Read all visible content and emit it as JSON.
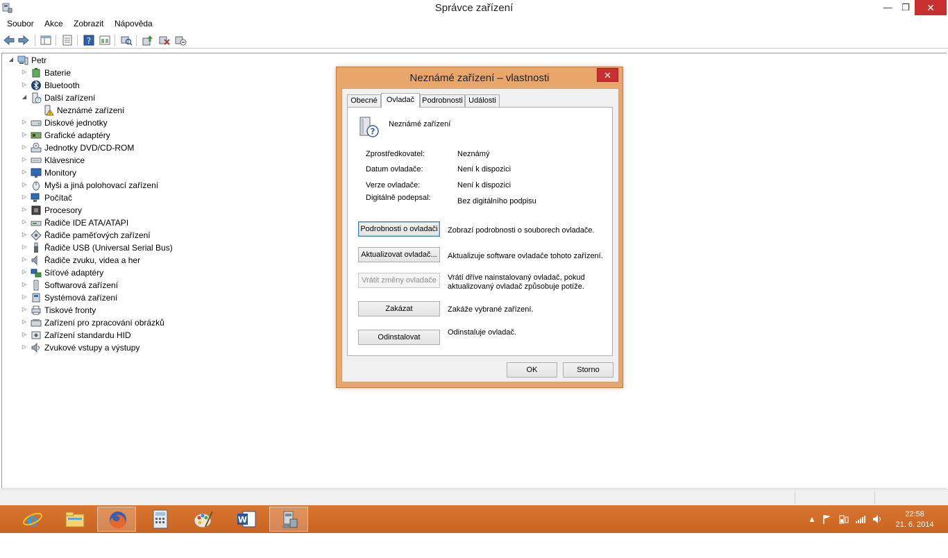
{
  "window": {
    "title": "Správce zařízení",
    "min_glyph": "—",
    "max_glyph": "❐",
    "close_glyph": "✕"
  },
  "menu": [
    "Soubor",
    "Akce",
    "Zobrazit",
    "Nápověda"
  ],
  "tree": {
    "root": "Petr",
    "items": [
      {
        "label": "Baterie",
        "icon": "battery-icon",
        "expanded": false
      },
      {
        "label": "Bluetooth",
        "icon": "bluetooth-icon",
        "expanded": false
      },
      {
        "label": "Další zařízení",
        "icon": "other-devices-icon",
        "expanded": true
      },
      {
        "label": "Neznámé zařízení",
        "icon": "unknown-device-warning-icon",
        "child": true
      },
      {
        "label": "Diskové jednotky",
        "icon": "disk-icon",
        "expanded": false
      },
      {
        "label": "Grafické adaptéry",
        "icon": "display-adapter-icon",
        "expanded": false
      },
      {
        "label": "Jednotky DVD/CD-ROM",
        "icon": "dvd-icon",
        "expanded": false
      },
      {
        "label": "Klávesnice",
        "icon": "keyboard-icon",
        "expanded": false
      },
      {
        "label": "Monitory",
        "icon": "monitor-icon",
        "expanded": false
      },
      {
        "label": "Myši a jiná polohovací zařízení",
        "icon": "mouse-icon",
        "expanded": false
      },
      {
        "label": "Počítač",
        "icon": "computer-icon",
        "expanded": false
      },
      {
        "label": "Procesory",
        "icon": "processor-icon",
        "expanded": false
      },
      {
        "label": "Řadiče IDE ATA/ATAPI",
        "icon": "ide-controller-icon",
        "expanded": false
      },
      {
        "label": "Řadiče paměťových zařízení",
        "icon": "storage-controller-icon",
        "expanded": false
      },
      {
        "label": "Řadiče USB (Universal Serial Bus)",
        "icon": "usb-icon",
        "expanded": false
      },
      {
        "label": "Řadiče zvuku, videa a her",
        "icon": "sound-icon",
        "expanded": false
      },
      {
        "label": "Síťové adaptéry",
        "icon": "network-adapter-icon",
        "expanded": false
      },
      {
        "label": "Softwarová zařízení",
        "icon": "software-device-icon",
        "expanded": false
      },
      {
        "label": "Systémová zařízení",
        "icon": "system-device-icon",
        "expanded": false
      },
      {
        "label": "Tiskové fronty",
        "icon": "printer-icon",
        "expanded": false
      },
      {
        "label": "Zařízení pro zpracování obrázků",
        "icon": "imaging-device-icon",
        "expanded": false
      },
      {
        "label": "Zařízení standardu HID",
        "icon": "hid-icon",
        "expanded": false
      },
      {
        "label": "Zvukové vstupy a výstupy",
        "icon": "audio-io-icon",
        "expanded": false
      }
    ]
  },
  "dialog": {
    "title": "Neznámé zařízení – vlastnosti",
    "close_glyph": "✕",
    "tabs": [
      "Obecné",
      "Ovladač",
      "Podrobnosti",
      "Události"
    ],
    "selected_tab": "Ovladač",
    "device_name": "Neznámé zařízení",
    "props": [
      {
        "label": "Zprostředkovatel:",
        "value": "Neznámý"
      },
      {
        "label": "Datum ovladače:",
        "value": "Není k dispozici"
      },
      {
        "label": "Verze ovladače:",
        "value": "Není k dispozici"
      },
      {
        "label": "Digitálně podepsal:",
        "value": "Bez digitálního podpisu"
      }
    ],
    "actions": [
      {
        "button": "Podrobnosti o ovladači",
        "desc": "Zobrazí podrobnosti o souborech ovladače."
      },
      {
        "button": "Aktualizovat ovladač...",
        "desc": "Aktualizuje software ovladače tohoto zařízení."
      },
      {
        "button": "Vrátit změny ovladače",
        "desc": "Vrátí dříve nainstalovaný ovladač, pokud aktualizovaný ovladač způsobuje potíže."
      },
      {
        "button": "Zakázat",
        "desc": "Zakáže vybrané zařízení."
      },
      {
        "button": "Odinstalovat",
        "desc": "Odinstaluje ovladač."
      }
    ],
    "ok": "OK",
    "cancel": "Storno"
  },
  "taskbar": {
    "apps": [
      "internet-explorer-icon",
      "file-explorer-icon",
      "firefox-icon",
      "calculator-icon",
      "paint-icon",
      "word-icon",
      "device-manager-icon"
    ],
    "active_app": "device-manager-icon",
    "clock": {
      "time": "22:58",
      "date": "21. 6. 2014"
    }
  },
  "colors": {
    "accent": "#d97632",
    "close": "#c7302e",
    "dialog_frame": "#e8a66a"
  }
}
